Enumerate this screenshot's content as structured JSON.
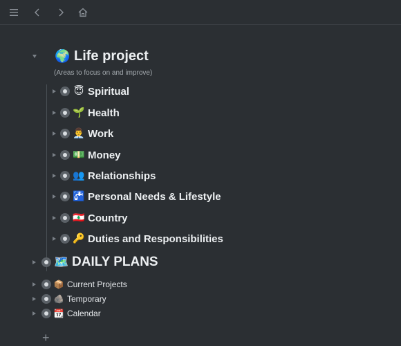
{
  "toolbar": {
    "menu_icon": "hamburger-menu-icon",
    "back_icon": "chevron-left-icon",
    "forward_icon": "chevron-right-icon",
    "home_icon": "home-icon"
  },
  "document": {
    "title_emoji": "🌍",
    "title": "Life project",
    "subtitle": "(Areas to focus on and improve)",
    "children": [
      {
        "emoji": "😇",
        "label": "Spiritual"
      },
      {
        "emoji": "🌱",
        "label": "Health"
      },
      {
        "emoji": "👨‍💼",
        "label": "Work"
      },
      {
        "emoji": "💵",
        "label": "Money"
      },
      {
        "emoji": "👥",
        "label": "Relationships"
      },
      {
        "emoji": "🚰",
        "label": "Personal Needs & Lifestyle"
      },
      {
        "emoji": "🇱🇧",
        "label": "Country"
      },
      {
        "emoji": "🔑",
        "label": "Duties and Responsibilities"
      }
    ]
  },
  "daily_plans": {
    "emoji": "🗺️",
    "label": "DAILY PLANS"
  },
  "other_items": [
    {
      "emoji": "📦",
      "label": "Current Projects"
    },
    {
      "emoji": "🪨",
      "label": "Temporary"
    },
    {
      "emoji": "📆",
      "label": "Calendar"
    }
  ],
  "add_label": "+",
  "colors": {
    "background": "#2b2f33",
    "text": "#eceff1",
    "muted": "#a3a9ae"
  }
}
